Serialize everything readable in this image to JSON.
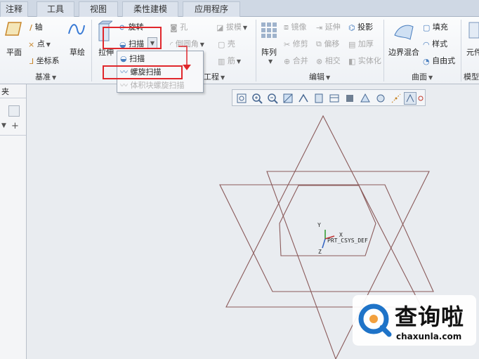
{
  "tabs": [
    "注释",
    "工具",
    "视图",
    "柔性建模",
    "应用程序"
  ],
  "datum_group": {
    "plane": "平面",
    "axis": "轴",
    "point": "点",
    "csys": "坐标系",
    "sketch": "草绘",
    "label": "基准"
  },
  "shapes_group": {
    "extrude": "拉伸",
    "revolve": "旋转",
    "sweep": "扫描"
  },
  "engineering_group": {
    "hole": "孔",
    "draft": "拔模",
    "round": "倒圆角",
    "shell": "壳",
    "rib": "筋",
    "label_partial": "工程"
  },
  "editing_group": {
    "pattern": "阵列",
    "mirror": "镜像",
    "extend": "延伸",
    "project": "投影",
    "trim": "修剪",
    "offset": "偏移",
    "thicken": "加厚",
    "merge": "合并",
    "intersect": "相交",
    "solidify": "实体化",
    "label": "编辑"
  },
  "surfaces_group": {
    "boundary_blend": "边界混合",
    "fill": "填充",
    "style": "样式",
    "freestyle": "自由式",
    "label": "曲面"
  },
  "partial_right": {
    "component": "元件",
    "model_intent": "模型"
  },
  "sweep_dropdown": {
    "items": [
      "扫描",
      "螺旋扫描",
      "体积块螺旋扫描"
    ]
  },
  "left_panel": {
    "header": "夹"
  },
  "csys_label": "PRT_CSYS_DEF",
  "csys_axes": {
    "x": "X",
    "y": "Y",
    "z": "Z"
  },
  "watermark": {
    "name": "查询啦",
    "url": "chaxunla.com"
  },
  "colors": {
    "highlight_box": "#e0272c",
    "sketch_lines": "#8a5a5a",
    "background": "#e9ecf0"
  }
}
